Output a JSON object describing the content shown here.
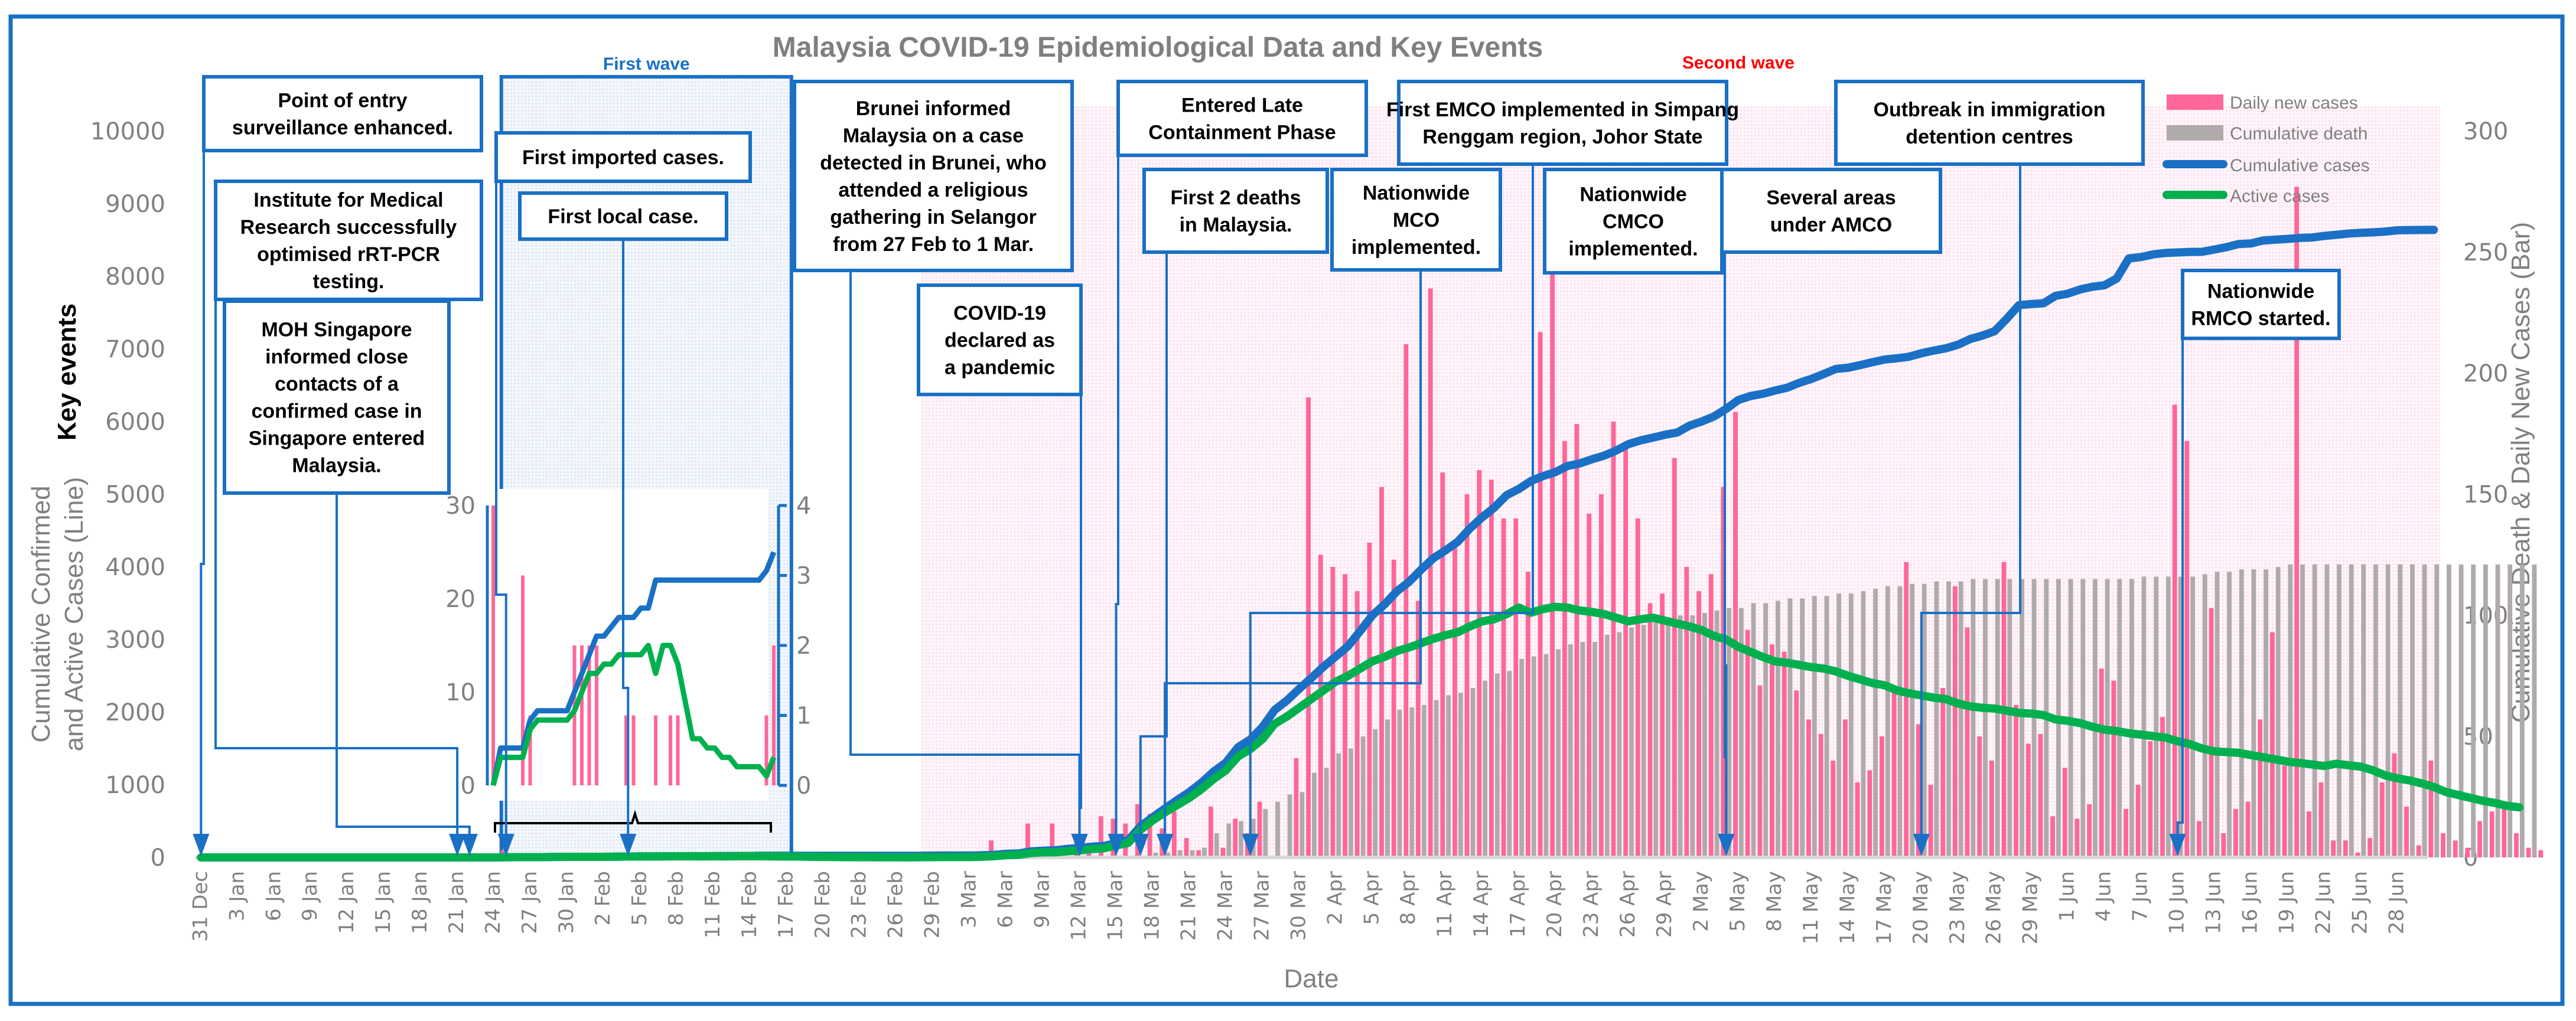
{
  "title": "Malaysia COVID-19 Epidemiological Data and Key Events",
  "key_events_label": "Key events",
  "first_wave_label": "First wave",
  "second_wave_label": "Second wave",
  "colors": {
    "frame": "#1a70c5",
    "daily_new": "#ff6699",
    "cumulative_death": "#b0aaaa",
    "cumulative_cases": "#1a70c5",
    "active_cases": "#00b04f",
    "second_wave_text": "#ff0000",
    "first_wave_text": "#1a70c5"
  },
  "events": [
    {
      "id": "poe",
      "lines": [
        "Point of entry",
        "surveillance enhanced."
      ],
      "date_index": 0
    },
    {
      "id": "imr",
      "lines": [
        "Institute for Medical",
        "Research successfully",
        "optimised rRT-PCR",
        "testing."
      ],
      "date_index": 21
    },
    {
      "id": "moh-sg",
      "lines": [
        "MOH Singapore",
        "informed close",
        "contacts of a",
        "confirmed case in",
        "Singapore entered",
        "Malaysia."
      ],
      "date_index": 22
    },
    {
      "id": "first-imported",
      "lines": [
        "First imported cases."
      ],
      "date_index": 25
    },
    {
      "id": "first-local",
      "lines": [
        "First local case."
      ],
      "date_index": 35
    },
    {
      "id": "brunei",
      "lines": [
        "Brunei informed",
        "Malaysia  on a case",
        "detected in Brunei, who",
        "attended a religious",
        "gathering in Selangor",
        "from 27 Feb to  1 Mar."
      ],
      "date_index": 72
    },
    {
      "id": "pandemic",
      "lines": [
        "COVID-19",
        "declared as",
        "a pandemic"
      ],
      "date_index": 72
    },
    {
      "id": "late-containment",
      "lines": [
        "Entered Late",
        "Containment Phase"
      ],
      "date_index": 75
    },
    {
      "id": "first-deaths",
      "lines": [
        "First 2 deaths",
        "in Malaysia."
      ],
      "date_index": 77
    },
    {
      "id": "mco",
      "lines": [
        "Nationwide",
        "MCO",
        "implemented."
      ],
      "date_index": 79
    },
    {
      "id": "emco",
      "lines": [
        "First EMCO implemented in Simpang",
        "Renggam region, Johor State"
      ],
      "date_index": 86
    },
    {
      "id": "cmco",
      "lines": [
        "Nationwide",
        "CMCO",
        "implemented."
      ],
      "date_index": 125
    },
    {
      "id": "amco",
      "lines": [
        "Several areas",
        "under AMCO"
      ],
      "date_index": 125
    },
    {
      "id": "immigration",
      "lines": [
        "Outbreak in immigration",
        "detention centres"
      ],
      "date_index": 141
    },
    {
      "id": "rmco",
      "lines": [
        "Nationwide",
        "RMCO started."
      ],
      "date_index": 162
    }
  ],
  "chart_data": {
    "type": "bar+line",
    "title": "Malaysia COVID-19 Epidemiological Data and Key Events",
    "xlabel": "Date",
    "ylabel_left": "Cumulative Confirmed and Active Cases (Line)",
    "ylabel_right": "Cumulative Death & Daily New Cases (Bar)",
    "ylim_left": [
      0,
      10000
    ],
    "ylim_right": [
      0,
      300
    ],
    "yticks_left": [
      "0",
      "1000",
      "2000",
      "3000",
      "4000",
      "5000",
      "6000",
      "7000",
      "8000",
      "9000",
      "10000"
    ],
    "yticks_right": [
      "0",
      "50",
      "100",
      "150",
      "200",
      "250",
      "300"
    ],
    "xticks": [
      "31 Dec",
      "3 Jan",
      "6 Jan",
      "9 Jan",
      "12 Jan",
      "15 Jan",
      "18 Jan",
      "21 Jan",
      "24 Jan",
      "27 Jan",
      "30 Jan",
      "2 Feb",
      "5 Feb",
      "8 Feb",
      "11 Feb",
      "14 Feb",
      "17 Feb",
      "20 Feb",
      "23 Feb",
      "26 Feb",
      "29 Feb",
      "3 Mar",
      "6 Mar",
      "9 Mar",
      "12 Mar",
      "15 Mar",
      "18 Mar",
      "21 Mar",
      "24 Mar",
      "27 Mar",
      "30 Mar",
      "2 Apr",
      "5 Apr",
      "8 Apr",
      "11 Apr",
      "14 Apr",
      "17 Apr",
      "20 Apr",
      "23 Apr",
      "26 Apr",
      "29 Apr",
      "2 May",
      "5 May",
      "8 May",
      "11 May",
      "14 May",
      "17 May",
      "20 May",
      "23 May",
      "26 May",
      "29 May",
      "1 Jun",
      "4 Jun",
      "7 Jun",
      "10 Jun",
      "13 Jun",
      "16 Jun",
      "19 Jun",
      "22 Jun",
      "25 Jun",
      "28 Jun"
    ],
    "legend": [
      {
        "name": "Daily new cases",
        "kind": "bar"
      },
      {
        "name": "Cumulative death",
        "kind": "bar"
      },
      {
        "name": "Cumulative cases",
        "kind": "line"
      },
      {
        "name": "Active cases",
        "kind": "line"
      }
    ],
    "legend_position": "top-right",
    "start_date": "31 Dec",
    "days": 183,
    "series": {
      "daily_new": [
        0,
        0,
        0,
        0,
        0,
        0,
        0,
        0,
        0,
        0,
        0,
        0,
        0,
        0,
        0,
        0,
        0,
        0,
        0,
        0,
        0,
        0,
        0,
        0,
        0,
        3,
        1,
        0,
        0,
        0,
        0,
        0,
        0,
        0,
        0,
        0,
        0,
        0,
        0,
        0,
        0,
        0,
        0,
        0,
        0,
        0,
        0,
        0,
        0,
        0,
        0,
        0,
        0,
        0,
        0,
        0,
        0,
        0,
        0,
        0,
        2,
        0,
        0,
        1,
        0,
        7,
        2,
        0,
        14,
        4,
        14,
        1,
        8,
        5,
        17,
        16,
        14,
        22,
        18,
        12,
        19,
        8,
        3,
        21,
        4,
        16,
        10,
        23,
        0,
        0,
        41,
        190,
        125,
        120,
        117,
        110,
        130,
        153,
        123,
        212,
        106,
        235,
        159,
        130,
        150,
        160,
        156,
        140,
        140,
        118,
        217,
        258,
        172,
        179,
        142,
        150,
        180,
        170,
        140,
        105,
        109,
        165,
        120,
        110,
        117,
        153,
        184,
        94,
        71,
        88,
        85,
        69,
        57,
        51,
        40,
        57,
        31,
        36,
        50,
        70,
        122,
        55,
        30,
        70,
        112,
        95,
        50,
        40,
        122,
        63,
        47,
        51,
        17,
        37,
        16,
        22,
        78,
        73,
        20,
        30,
        48,
        58,
        187,
        172,
        15,
        103,
        10,
        20,
        23,
        57,
        93,
        38,
        277,
        19,
        31,
        7,
        7,
        2,
        8,
        31,
        43,
        21,
        5,
        40,
        10,
        7,
        4,
        15,
        19,
        20,
        10,
        4,
        3
      ],
      "cumulative_death": [
        0,
        0,
        0,
        0,
        0,
        0,
        0,
        0,
        0,
        0,
        0,
        0,
        0,
        0,
        0,
        0,
        0,
        0,
        0,
        0,
        0,
        0,
        0,
        0,
        0,
        0,
        0,
        0,
        0,
        0,
        0,
        0,
        0,
        0,
        0,
        0,
        0,
        0,
        0,
        0,
        0,
        0,
        0,
        0,
        0,
        0,
        0,
        0,
        0,
        0,
        0,
        0,
        0,
        0,
        0,
        0,
        0,
        0,
        0,
        0,
        0,
        0,
        0,
        0,
        0,
        0,
        0,
        0,
        0,
        0,
        0,
        0,
        0,
        0,
        0,
        0,
        0,
        0,
        2,
        2,
        3,
        3,
        4,
        10,
        14,
        15,
        16,
        20,
        23,
        26,
        27,
        35,
        37,
        43,
        45,
        50,
        53,
        57,
        61,
        62,
        63,
        65,
        67,
        68,
        70,
        73,
        76,
        77,
        82,
        83,
        84,
        86,
        88,
        89,
        89,
        92,
        93,
        95,
        96,
        98,
        99,
        100,
        100,
        101,
        102,
        103,
        103,
        105,
        105,
        106,
        107,
        107,
        108,
        108,
        109,
        109,
        110,
        111,
        112,
        112,
        113,
        113,
        114,
        114,
        114,
        115,
        115,
        115,
        115,
        115,
        115,
        115,
        115,
        115,
        115,
        115,
        115,
        115,
        115,
        116,
        116,
        116,
        116,
        116,
        117,
        118,
        118,
        119,
        119,
        119,
        120,
        121,
        121,
        121,
        121,
        121,
        121,
        121,
        121,
        121,
        121,
        121,
        121,
        121,
        121,
        121,
        121,
        121,
        121,
        121,
        121,
        121
      ],
      "cumulative_cases": [
        0,
        0,
        0,
        0,
        0,
        0,
        0,
        0,
        0,
        0,
        0,
        0,
        0,
        0,
        0,
        0,
        0,
        0,
        0,
        0,
        0,
        0,
        0,
        0,
        0,
        3,
        4,
        4,
        4,
        7,
        8,
        8,
        8,
        8,
        10,
        12,
        14,
        14,
        15,
        16,
        16,
        16,
        18,
        18,
        19,
        19,
        22,
        22,
        22,
        22,
        22,
        22,
        22,
        22,
        22,
        22,
        22,
        22,
        22,
        22,
        24,
        25,
        25,
        25,
        29,
        36,
        50,
        55,
        83,
        93,
        99,
        117,
        129,
        149,
        158,
        197,
        238,
        428,
        553,
        673,
        790,
        900,
        1030,
        1183,
        1306,
        1518,
        1624,
        1796,
        2031,
        2161,
        2320,
        2470,
        2626,
        2766,
        2908,
        3116,
        3333,
        3483,
        3662,
        3793,
        3963,
        4119,
        4228,
        4346,
        4530,
        4683,
        4817,
        4987,
        5072,
        5182,
        5251,
        5305,
        5389,
        5425,
        5482,
        5532,
        5603,
        5691,
        5742,
        5780,
        5820,
        5851,
        5945,
        6002,
        6071,
        6176,
        6298,
        6353,
        6383,
        6428,
        6467,
        6535,
        6589,
        6656,
        6726,
        6742,
        6779,
        6819,
        6855,
        6872,
        6894,
        6941,
        6978,
        7009,
        7059,
        7137,
        7185,
        7245,
        7417,
        7604,
        7619,
        7629,
        7732,
        7762,
        7819,
        7857,
        7877,
        7970,
        8247,
        8266,
        8303,
        8322,
        8329,
        8336,
        8338,
        8369,
        8402,
        8445,
        8453,
        8494,
        8505,
        8515,
        8529,
        8535,
        8556,
        8572,
        8590,
        8600,
        8606,
        8616,
        8634,
        8637,
        8639,
        8640
      ],
      "active_cases": [
        0,
        0,
        0,
        0,
        0,
        0,
        0,
        0,
        0,
        0,
        0,
        0,
        0,
        0,
        0,
        0,
        0,
        0,
        0,
        0,
        0,
        0,
        0,
        0,
        0,
        3,
        4,
        4,
        4,
        7,
        8,
        8,
        8,
        8,
        10,
        12,
        13,
        13,
        14,
        15,
        15,
        14,
        15,
        14,
        16,
        16,
        16,
        14,
        12,
        12,
        8,
        7,
        5,
        4,
        3,
        3,
        2,
        2,
        1,
        3,
        4,
        5,
        5,
        5,
        9,
        16,
        30,
        35,
        60,
        70,
        70,
        85,
        95,
        115,
        125,
        165,
        200,
        380,
        510,
        620,
        720,
        820,
        940,
        1080,
        1200,
        1390,
        1490,
        1630,
        1840,
        1940,
        2060,
        2180,
        2300,
        2420,
        2500,
        2600,
        2700,
        2760,
        2840,
        2890,
        2950,
        3010,
        3060,
        3100,
        3180,
        3250,
        3280,
        3350,
        3440,
        3370,
        3420,
        3450,
        3440,
        3400,
        3380,
        3350,
        3300,
        3250,
        3280,
        3300,
        3260,
        3220,
        3180,
        3130,
        3050,
        3000,
        2900,
        2830,
        2760,
        2700,
        2680,
        2650,
        2620,
        2600,
        2560,
        2500,
        2450,
        2400,
        2370,
        2300,
        2260,
        2230,
        2200,
        2180,
        2120,
        2080,
        2060,
        2050,
        2020,
        1990,
        1980,
        1960,
        1900,
        1880,
        1850,
        1800,
        1760,
        1740,
        1710,
        1690,
        1670,
        1650,
        1600,
        1560,
        1500,
        1460,
        1450,
        1440,
        1410,
        1380,
        1350,
        1320,
        1300,
        1280,
        1260,
        1290,
        1270,
        1250,
        1200,
        1130,
        1090,
        1060,
        1020,
        970,
        900,
        860,
        820,
        780,
        750,
        710,
        690
      ]
    },
    "inset": {
      "ylim_left": [
        0,
        30
      ],
      "ylim_right": [
        0,
        4
      ],
      "yticks_left": [
        "0",
        "10",
        "20",
        "30"
      ],
      "yticks_right": [
        "0",
        "1",
        "2",
        "3",
        "4"
      ],
      "daily_new": [
        4,
        0,
        0,
        0,
        3,
        1,
        0,
        0,
        0,
        0,
        0,
        2,
        2,
        2,
        2,
        0,
        0,
        0,
        1,
        1,
        0,
        0,
        1,
        0,
        1,
        1,
        0,
        0,
        0,
        0,
        0,
        0,
        0,
        0,
        0,
        0,
        0,
        1,
        2
      ],
      "cumulative_cases": [
        0,
        4,
        4,
        4,
        4,
        7,
        8,
        8,
        8,
        8,
        8,
        10,
        12,
        14,
        16,
        16,
        17,
        18,
        18,
        18,
        19,
        19,
        22,
        22,
        22,
        22,
        22,
        22,
        22,
        22,
        22,
        22,
        22,
        22,
        22,
        22,
        22,
        23,
        25
      ],
      "active_cases": [
        0,
        3,
        3,
        3,
        3,
        6,
        7,
        7,
        7,
        7,
        7,
        8,
        10,
        12,
        12,
        13,
        13,
        14,
        14,
        14,
        14,
        15,
        12,
        15,
        15,
        13,
        9,
        5,
        5,
        4,
        4,
        3,
        3,
        2,
        2,
        2,
        2,
        1,
        3
      ]
    }
  }
}
